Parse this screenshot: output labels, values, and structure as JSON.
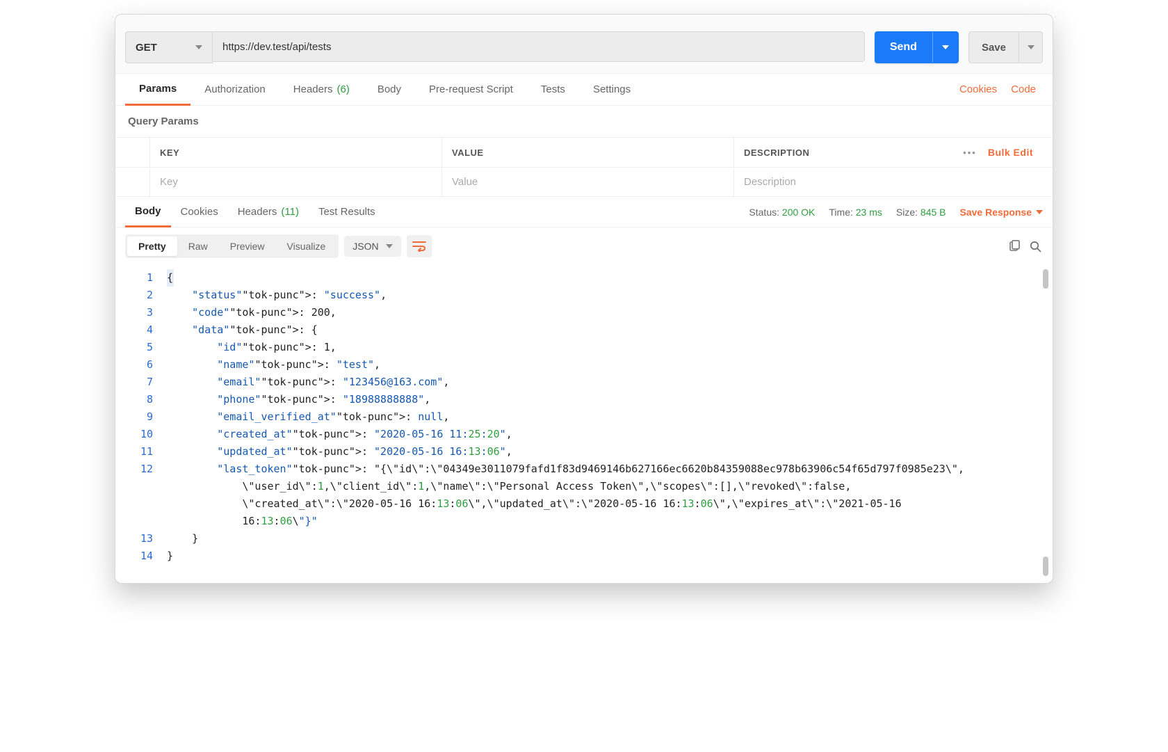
{
  "request": {
    "method": "GET",
    "url": "https://dev.test/api/tests",
    "send_label": "Send",
    "save_label": "Save"
  },
  "request_tabs": {
    "params": "Params",
    "authorization": "Authorization",
    "headers": "Headers",
    "headers_count": "(6)",
    "body": "Body",
    "prerequest": "Pre-request Script",
    "tests": "Tests",
    "settings": "Settings",
    "cookies_link": "Cookies",
    "code_link": "Code"
  },
  "query_params": {
    "title": "Query Params",
    "key_header": "KEY",
    "value_header": "VALUE",
    "description_header": "DESCRIPTION",
    "key_placeholder": "Key",
    "value_placeholder": "Value",
    "description_placeholder": "Description",
    "bulk_edit": "Bulk Edit"
  },
  "response_tabs": {
    "body": "Body",
    "cookies": "Cookies",
    "headers": "Headers",
    "headers_count": "(11)",
    "test_results": "Test Results",
    "status_label": "Status:",
    "status_value": "200 OK",
    "time_label": "Time:",
    "time_value": "23 ms",
    "size_label": "Size:",
    "size_value": "845 B",
    "save_response": "Save Response"
  },
  "response_toolbar": {
    "pretty": "Pretty",
    "raw": "Raw",
    "preview": "Preview",
    "visualize": "Visualize",
    "format": "JSON"
  },
  "code_lines": {
    "l1": "{",
    "l2": "    \"status\": \"success\",",
    "l3": "    \"code\": 200,",
    "l4": "    \"data\": {",
    "l5": "        \"id\": 1,",
    "l6": "        \"name\": \"test\",",
    "l7": "        \"email\": \"123456@163.com\",",
    "l8": "        \"phone\": \"18988888888\",",
    "l9": "        \"email_verified_at\": null,",
    "l10": "        \"created_at\": \"2020-05-16 11:25:20\",",
    "l11": "        \"updated_at\": \"2020-05-16 16:13:06\",",
    "l12a": "        \"last_token\": \"{\\\"id\\\":\\\"04349e3011079fafd1f83d9469146b627166ec6620b84359088ec978b63906c54f65d797f0985e23\\\",",
    "l12b": "            \\\"user_id\\\":1,\\\"client_id\\\":1,\\\"name\\\":\\\"Personal Access Token\\\",\\\"scopes\\\":[],\\\"revoked\\\":false,",
    "l12c": "            \\\"created_at\\\":\\\"2020-05-16 16:13:06\\\",\\\"updated_at\\\":\\\"2020-05-16 16:13:06\\\",\\\"expires_at\\\":\\\"2021-05-16",
    "l12d": "            16:13:06\\\"}\"",
    "l13": "    }",
    "l14": "}"
  },
  "line_numbers": [
    "1",
    "2",
    "3",
    "4",
    "5",
    "6",
    "7",
    "8",
    "9",
    "10",
    "11",
    "12",
    "",
    "",
    "",
    "13",
    "14"
  ]
}
